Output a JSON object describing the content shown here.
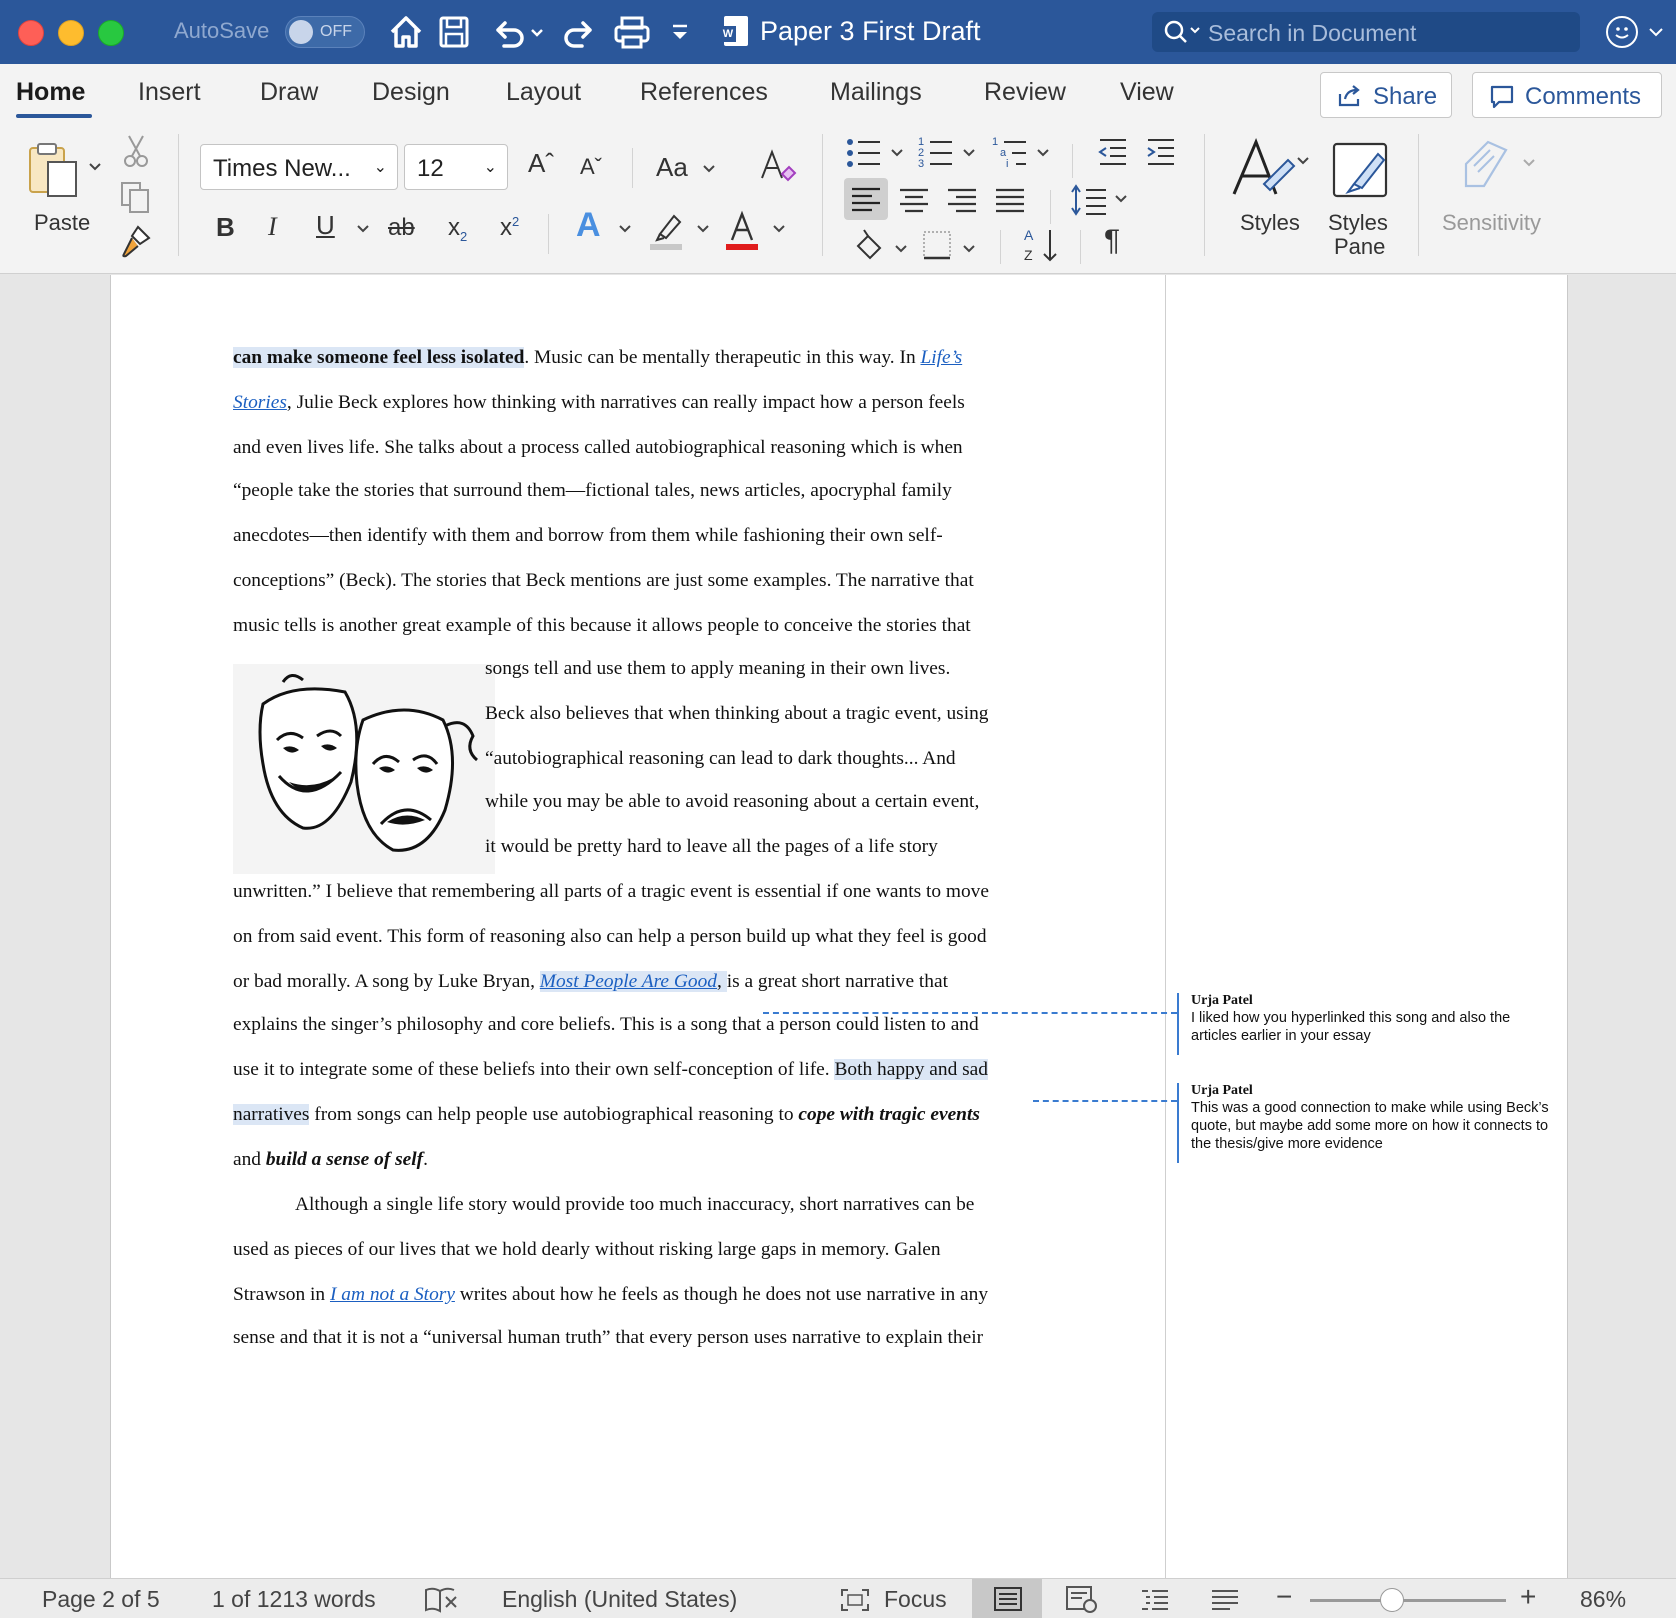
{
  "titlebar": {
    "autosave_label": "AutoSave",
    "autosave_state": "OFF",
    "doc_title": "Paper 3 First Draft",
    "search_placeholder": "Search in Document"
  },
  "tabs": [
    "Home",
    "Insert",
    "Draw",
    "Design",
    "Layout",
    "References",
    "Mailings",
    "Review",
    "View"
  ],
  "ribbon": {
    "share_label": "Share",
    "comments_label": "Comments",
    "paste_label": "Paste",
    "font_name": "Times New...",
    "font_size": "12",
    "change_case": "Aa",
    "styles_label": "Styles",
    "styles_pane_label_1": "Styles",
    "styles_pane_label_2": "Pane",
    "sensitivity_label": "Sensitivity",
    "bold": "B",
    "italic": "I",
    "underline": "U",
    "strike": "ab",
    "subscript": "x",
    "superscript": "x",
    "pilcrow": "¶"
  },
  "doc": {
    "l1_a": "can make someone feel less isolated",
    "l1_b": ". Music can be mentally therapeutic in this way. In ",
    "l1_link": "Life’s",
    "l2_link": "Stories",
    "l2_b": ", Julie Beck explores how thinking with narratives can really impact how a person feels",
    "l3": "and even lives life. She talks about a process called autobiographical reasoning which is when",
    "l4": "“people take the stories that surround them—fictional tales, news articles, apocryphal family",
    "l5": "anecdotes—then identify with them and borrow from them while fashioning their own self-",
    "l6": "conceptions” (Beck). The stories that Beck mentions are just some examples. The narrative that",
    "l7": "music tells is another great example of this because it allows people to conceive the stories that",
    "l8": "songs tell and use them to apply meaning in their own lives.",
    "l9": "Beck also believes that when thinking about a tragic event, using",
    "l10": "“autobiographical reasoning can lead to dark thoughts... And",
    "l11": "while you may be able to avoid reasoning about a certain event,",
    "l12": "it would be pretty hard to leave all the pages of a life story",
    "l13": "unwritten.” I believe that remembering all parts of a tragic event is essential if one wants to move",
    "l14": "on from said event. This form of reasoning also can help a person build up what they feel is good",
    "l15_a": "or bad morally. A song by Luke Bryan, ",
    "l15_link": "Most People Are Good",
    "l15_b": ", ",
    "l15_c": "is a great short narrative that",
    "l16": "explains the singer’s philosophy and core beliefs. This is a song that a person could listen to and",
    "l17_a": "use it to integrate some of these beliefs into their own self-conception of life. ",
    "l17_hl": "Both happy and sad",
    "l18_hl": "narratives",
    "l18_b": " from songs can help people use autobiographical reasoning to ",
    "l18_bi": "cope with tragic events",
    "l19_a": "and ",
    "l19_bi": "build a sense of self",
    "l19_b": ".",
    "l20": "Although a single life story would provide too much inaccuracy, short narratives can be",
    "l21": "used as pieces of our lives that we hold dearly without risking large gaps in memory. Galen",
    "l22_a": "Strawson in ",
    "l22_link": "I am not a Story",
    "l22_b": " writes about how he feels as though he does not use narrative in any",
    "l23": "sense and that it is not a “universal human truth” that every person uses narrative to explain their"
  },
  "comments": [
    {
      "author": "Urja Patel",
      "text": "I liked how you hyperlinked this song and also the articles earlier in your essay"
    },
    {
      "author": "Urja Patel",
      "text": "This was a good connection to make while using Beck’s quote, but maybe add some more on how it connects to the thesis/give more evidence"
    }
  ],
  "status": {
    "page": "Page 2 of 5",
    "words": "1 of 1213 words",
    "language": "English (United States)",
    "focus": "Focus",
    "zoom": "86%"
  },
  "colors": {
    "brand": "#2b579a",
    "link": "#1b5fc1",
    "comment_line": "#3a7bd0"
  }
}
